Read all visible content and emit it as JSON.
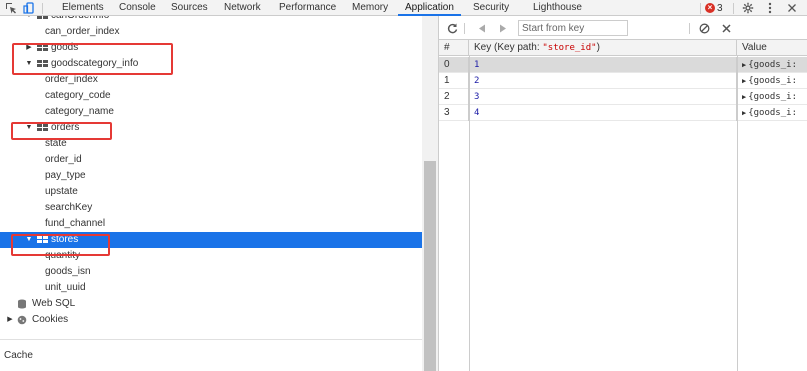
{
  "tabbar": {
    "tabs": [
      "Elements",
      "Console",
      "Sources",
      "Network",
      "Performance",
      "Memory",
      "Application",
      "Security",
      "Lighthouse"
    ],
    "active_tab": "Application",
    "error_count": "3",
    "icons": [
      "inspect-icon",
      "device-toolbar-icon",
      "error-icon",
      "settings-icon",
      "more-options-icon",
      "close-icon"
    ]
  },
  "tree": {
    "rows": [
      {
        "label": "canOrderInfo",
        "indent": 2,
        "type": "store",
        "expanded": true
      },
      {
        "label": "can_order_index",
        "indent": 3,
        "type": "index"
      },
      {
        "label": "goods",
        "indent": 2,
        "type": "store",
        "expanded": false
      },
      {
        "label": "goodscategory_info",
        "indent": 2,
        "type": "store",
        "expanded": true
      },
      {
        "label": "order_index",
        "indent": 3,
        "type": "index"
      },
      {
        "label": "category_code",
        "indent": 3,
        "type": "index"
      },
      {
        "label": "category_name",
        "indent": 3,
        "type": "index"
      },
      {
        "label": "orders",
        "indent": 2,
        "type": "store",
        "expanded": true
      },
      {
        "label": "state",
        "indent": 3,
        "type": "index"
      },
      {
        "label": "order_id",
        "indent": 3,
        "type": "index"
      },
      {
        "label": "pay_type",
        "indent": 3,
        "type": "index"
      },
      {
        "label": "upstate",
        "indent": 3,
        "type": "index"
      },
      {
        "label": "searchKey",
        "indent": 3,
        "type": "index"
      },
      {
        "label": "fund_channel",
        "indent": 3,
        "type": "index"
      },
      {
        "label": "stores",
        "indent": 2,
        "type": "store",
        "expanded": true,
        "selected": true
      },
      {
        "label": "quantity",
        "indent": 3,
        "type": "index"
      },
      {
        "label": "goods_isn",
        "indent": 3,
        "type": "index"
      },
      {
        "label": "unit_uuid",
        "indent": 3,
        "type": "index"
      },
      {
        "label": "Web SQL",
        "indent": 1,
        "type": "websql"
      },
      {
        "label": "Cookies",
        "indent": 0,
        "type": "cookies",
        "expanded": false
      }
    ],
    "section_cache": "Cache"
  },
  "toolbar": {
    "search_placeholder": "Start from key",
    "icons": [
      "refresh-icon",
      "prev-page-icon",
      "next-page-icon",
      "clear-icon",
      "delete-icon"
    ]
  },
  "table": {
    "headers": {
      "num": "#",
      "key": "Key (Key path: ",
      "keypath": "\"store_id\"",
      "key_close": ")",
      "value": "Value"
    },
    "rows": [
      {
        "num": "0",
        "key": "1",
        "value": "{goods_i:"
      },
      {
        "num": "1",
        "key": "2",
        "value": "{goods_i:"
      },
      {
        "num": "2",
        "key": "3",
        "value": "{goods_i:"
      },
      {
        "num": "3",
        "key": "4",
        "value": "{goods_i:"
      }
    ]
  },
  "colors": {
    "selection": "#1a73e8",
    "annotation": "#e53935",
    "keypath": "#c80000",
    "key": "#1a1aa6"
  }
}
